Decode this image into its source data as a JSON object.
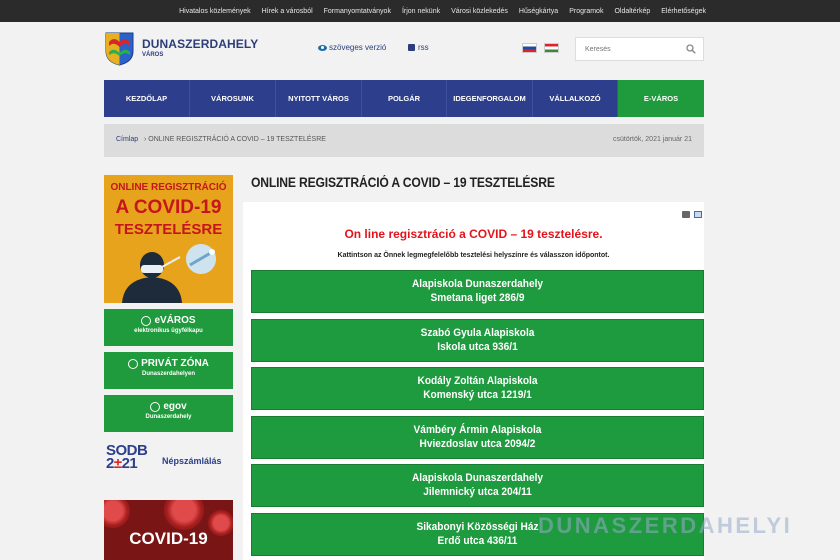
{
  "topbar": {
    "links": [
      "Hivatalos közlemények",
      "Hírek a városból",
      "Formanyomtatványok",
      "Írjon nekünk",
      "Városi közlekedés",
      "Hűségkártya",
      "Programok",
      "Oldaltérkép",
      "Elérhetőségek"
    ]
  },
  "header": {
    "logo_title": "DUNASZERDAHELY",
    "logo_subtitle": "VÁROS",
    "text_version": "szöveges verzió",
    "rss": "rss",
    "search_placeholder": "Keresés"
  },
  "nav": {
    "items": [
      "KEZDŐLAP",
      "VÁROSUNK",
      "NYITOTT VÁROS",
      "POLGÁR",
      "IDEGENFORGALOM",
      "VÁLLALKOZÓ",
      "E-VÁROS"
    ]
  },
  "breadcrumb": {
    "home": "Címlap",
    "separator": "›",
    "current": "ONLINE REGISZTRÁCIÓ A COVID – 19 TESZTELÉSRE",
    "date": "csütörtök, 2021 január 21"
  },
  "sidebar": {
    "covid_banner": {
      "line1": "ONLINE REGISZTRÁCIÓ",
      "line2": "A COVID-19",
      "line3": "TESZTELÉSRE"
    },
    "buttons": [
      {
        "title": "eVÁROS",
        "subtitle": "elektronikus ügyfélkapu",
        "icon": "globe-icon"
      },
      {
        "title": "PRIVÁT ZÓNA",
        "subtitle": "Dunaszerdahelyen",
        "icon": "user-icon"
      },
      {
        "title": "egov",
        "subtitle": "Dunaszerdahely",
        "icon": "info-icon"
      }
    ],
    "sodb": {
      "logo_top": "SODB",
      "logo_bottom_a": "2",
      "logo_bottom_plus": "±",
      "logo_bottom_b": "21",
      "label": "Népszámlálás"
    },
    "covid_card": "COVID-19"
  },
  "content": {
    "title": "ONLINE REGISZTRÁCIÓ A COVID – 19 TESZTELÉSRE",
    "heading": "On line regisztráció a COVID – 19 tesztelésre.",
    "instruction": "Kattintson az Önnek legmegfelelőbb tesztelési helyszínre és válasszon időpontot.",
    "locations": [
      {
        "name": "Alapiskola Dunaszerdahely",
        "address": "Smetana liget 286/9"
      },
      {
        "name": "Szabó Gyula Alapiskola",
        "address": "Iskola utca 936/1"
      },
      {
        "name": "Kodály Zoltán Alapiskola",
        "address": "Komenský utca 1219/1"
      },
      {
        "name": "Vámbéry Ármin Alapiskola",
        "address": "Hviezdoslav utca 2094/2"
      },
      {
        "name": "Alapiskola Dunaszerdahely",
        "address": "Jilemnický utca 204/11"
      },
      {
        "name": "Sikabonyi Közösségi Ház",
        "address": "Erdő utca 436/11"
      }
    ]
  },
  "watermark": "DUNASZERDAHELYI",
  "colors": {
    "nav_blue": "#2c3e8c",
    "green": "#1e9b3e",
    "red": "#e3141b",
    "banner_orange": "#e8a31c"
  }
}
